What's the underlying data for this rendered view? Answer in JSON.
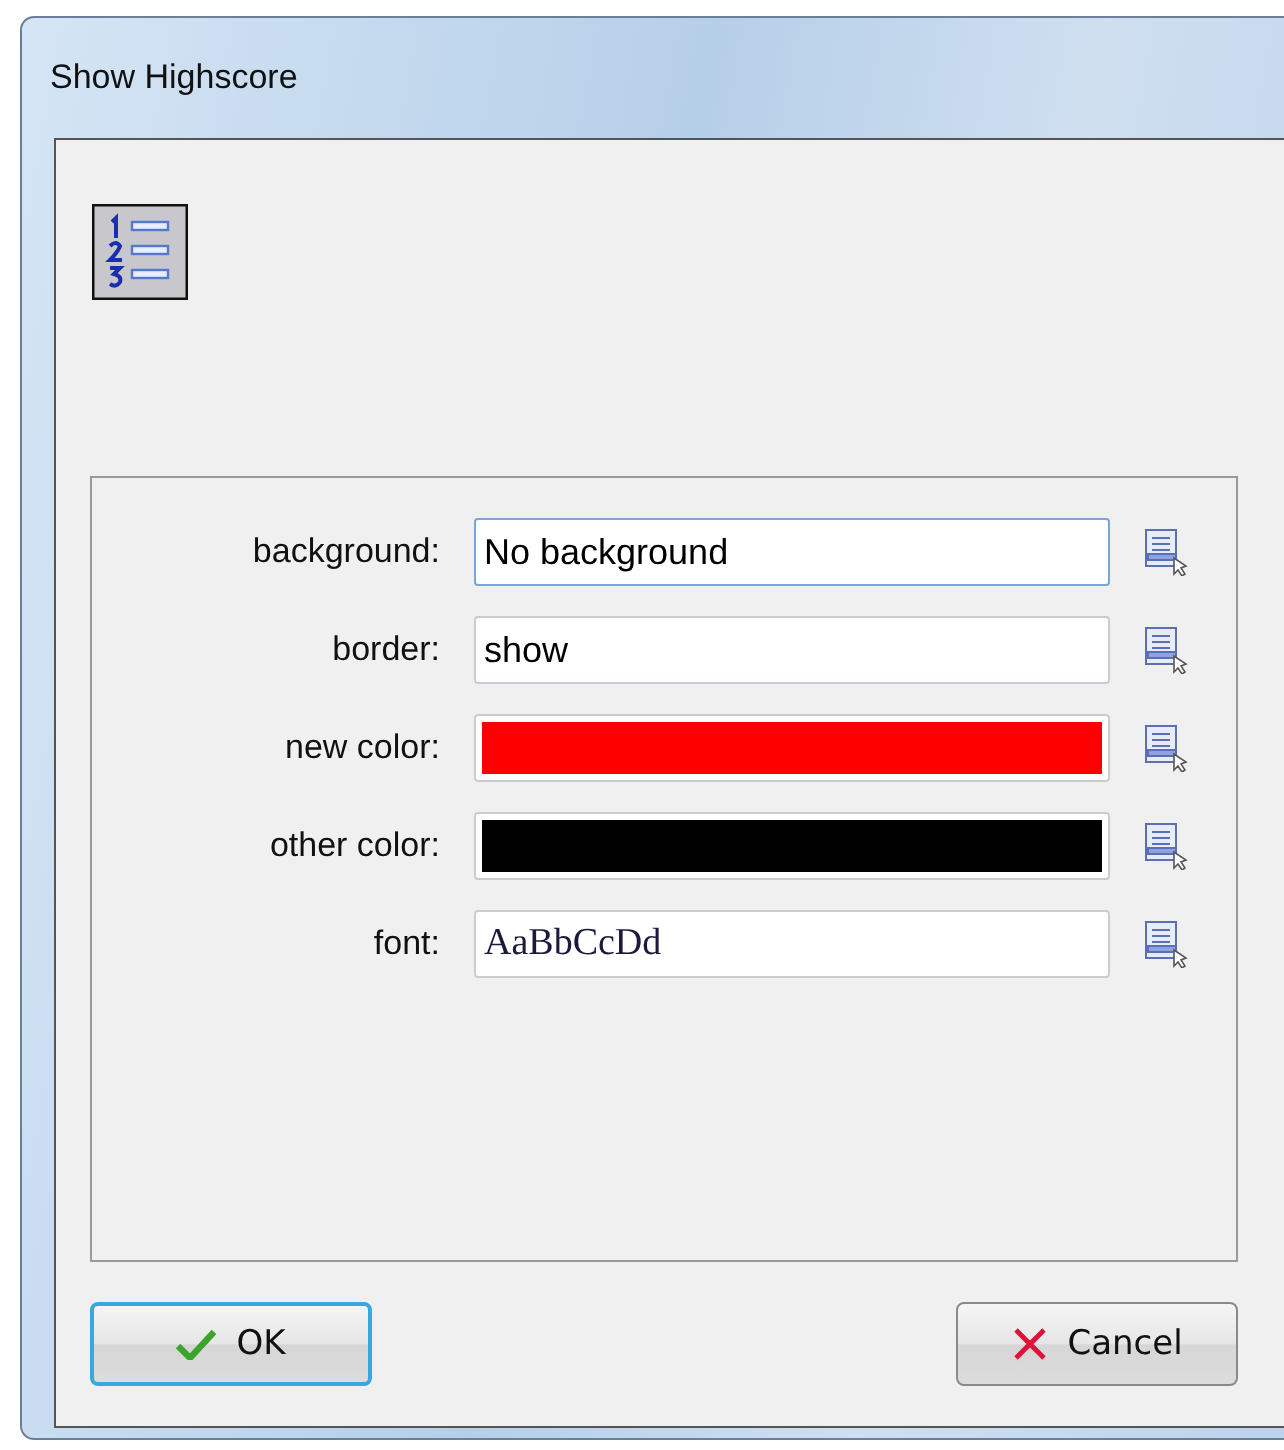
{
  "window": {
    "title": "Show Highscore"
  },
  "properties": [
    {
      "label": "background:",
      "kind": "text",
      "value": "No background",
      "focused": true
    },
    {
      "label": "border:",
      "kind": "text",
      "value": "show",
      "focused": false
    },
    {
      "label": "new color:",
      "kind": "color",
      "color": "#ff0000",
      "focused": false
    },
    {
      "label": "other color:",
      "kind": "color",
      "color": "#000000",
      "focused": false
    },
    {
      "label": "font:",
      "kind": "font",
      "value": "AaBbCcDd",
      "focused": false
    }
  ],
  "buttons": [
    {
      "label": "OK",
      "kind": "ok",
      "default": true
    },
    {
      "label": "Cancel",
      "kind": "cancel",
      "default": false
    }
  ]
}
